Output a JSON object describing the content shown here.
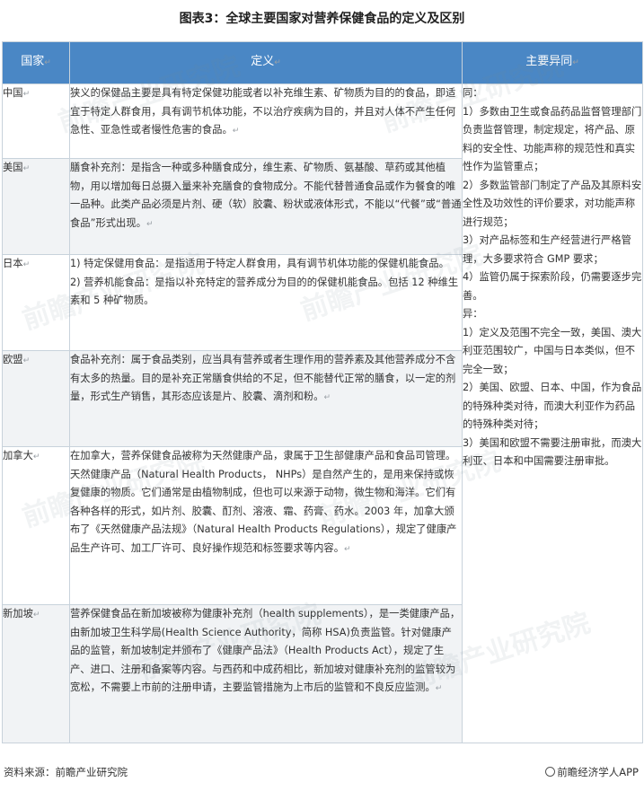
{
  "title": "图表3：全球主要国家对营养保健食品的定义及区别",
  "header": {
    "col_country": "国家",
    "col_definition": "定义",
    "col_differences": "主要异同"
  },
  "rows": [
    {
      "country": "中国",
      "definition": "狭义的保健品主要是具有特定保健功能或者以补充维生素、矿物质为目的的食品，即适宜于特定人群食用，具有调节机体功能，不以治疗疾病为目的，并且对人体不产生任何急性、亚急性或者慢性危害的食品。"
    },
    {
      "country": "美国",
      "definition": "膳食补充剂：是指含一种或多种膳食成分，维生素、矿物质、氨基酸、草药或其他植物，用以增加每日总摄入量来补充膳食的食物成分。不能代替普通食品或作为餐食的唯一品种。此类产品必须是片剂、硬（软）胶囊、粉状或液体形式，不能以“代餐”或“普通食品”形式出现。"
    },
    {
      "country": "日本",
      "definition": "1) 特定保健用食品：是指适用于特定人群食用，具有调节机体功能的保健机能食品。",
      "definition2": "2) 营养机能食品：是指以补充特定的营养成分为目的的保健机能食品。包括 12 种维生素和 5 种矿物质。"
    },
    {
      "country": "欧盟",
      "definition": "食品补充剂：属于食品类别，应当具有营养或者生理作用的营养素及其他营养成分不含有太多的热量。目的是补充正常膳食供给的不足，但不能替代正常的膳食，以一定的剂量，形式生产销售，其形态应该是片、胶囊、滴剂和粉。"
    },
    {
      "country": "加拿大",
      "definition": "在加拿大，营养保健食品被称为天然健康产品，隶属于卫生部健康产品和食品司管理。天然健康产品（Natural Health Products， NHPs）是自然产生的，是用来保持或恢复健康的物质。它们通常是由植物制成，但也可以来源于动物，微生物和海洋。它们有各种各样的形式，如片剂、胶囊、酊剂、溶液、霜、药膏、药水。2003 年，加拿大颁布了《天然健康产品法规》（Natural Health Products Regulations），规定了健康产品生产许可、加工厂许可、良好操作规范和标签要求等内容。"
    },
    {
      "country": "新加坡",
      "definition": "营养保健食品在新加坡被称为健康补充剂（health supplements），是一类健康产品，由新加坡卫生科学局(Health Science Authority，简称 HSA)负责监管。针对健康产品的监管，新加坡制定并颁布了《健康产品法》（Health Products Act），规定了生产、进口、注册和备案等内容。与西药和中成药相比，新加坡对健康补充剂的监管较为宽松，不需要上市前的注册申请，主要监管措施为上市后的监管和不良反应监测。"
    }
  ],
  "differences": [
    "同：",
    "1）多数由卫生或食品药品监督管理部门负责监督管理，制定规定，将产品、原料的安全性、功能声称的规范性和真实性作为监管重点；",
    "2）多数监管部门制定了产品及其原料安全性及功效性的评价要求，对功能声称进行规范；",
    "3）对产品标签和生产经营进行严格管理，大多要求符合 GMP 要求；",
    "4）监管仍属于探索阶段，仍需要逐步完善。",
    "异：",
    "1）定义及范围不完全一致，美国、澳大利亚范围较广，中国与日本类似，但不完全一致；",
    "2）美国、欧盟、日本、中国，作为食品的特殊种类对待，而澳大利亚作为药品的特殊种类对待；",
    "3）美国和欧盟不需要注册审批，而澳大利亚、日本和中国需要注册审批。"
  ],
  "footer": {
    "source": "资料来源：前瞻产业研究院",
    "brand": "前瞻经济学人APP"
  },
  "watermark": "前瞻产业研究院"
}
